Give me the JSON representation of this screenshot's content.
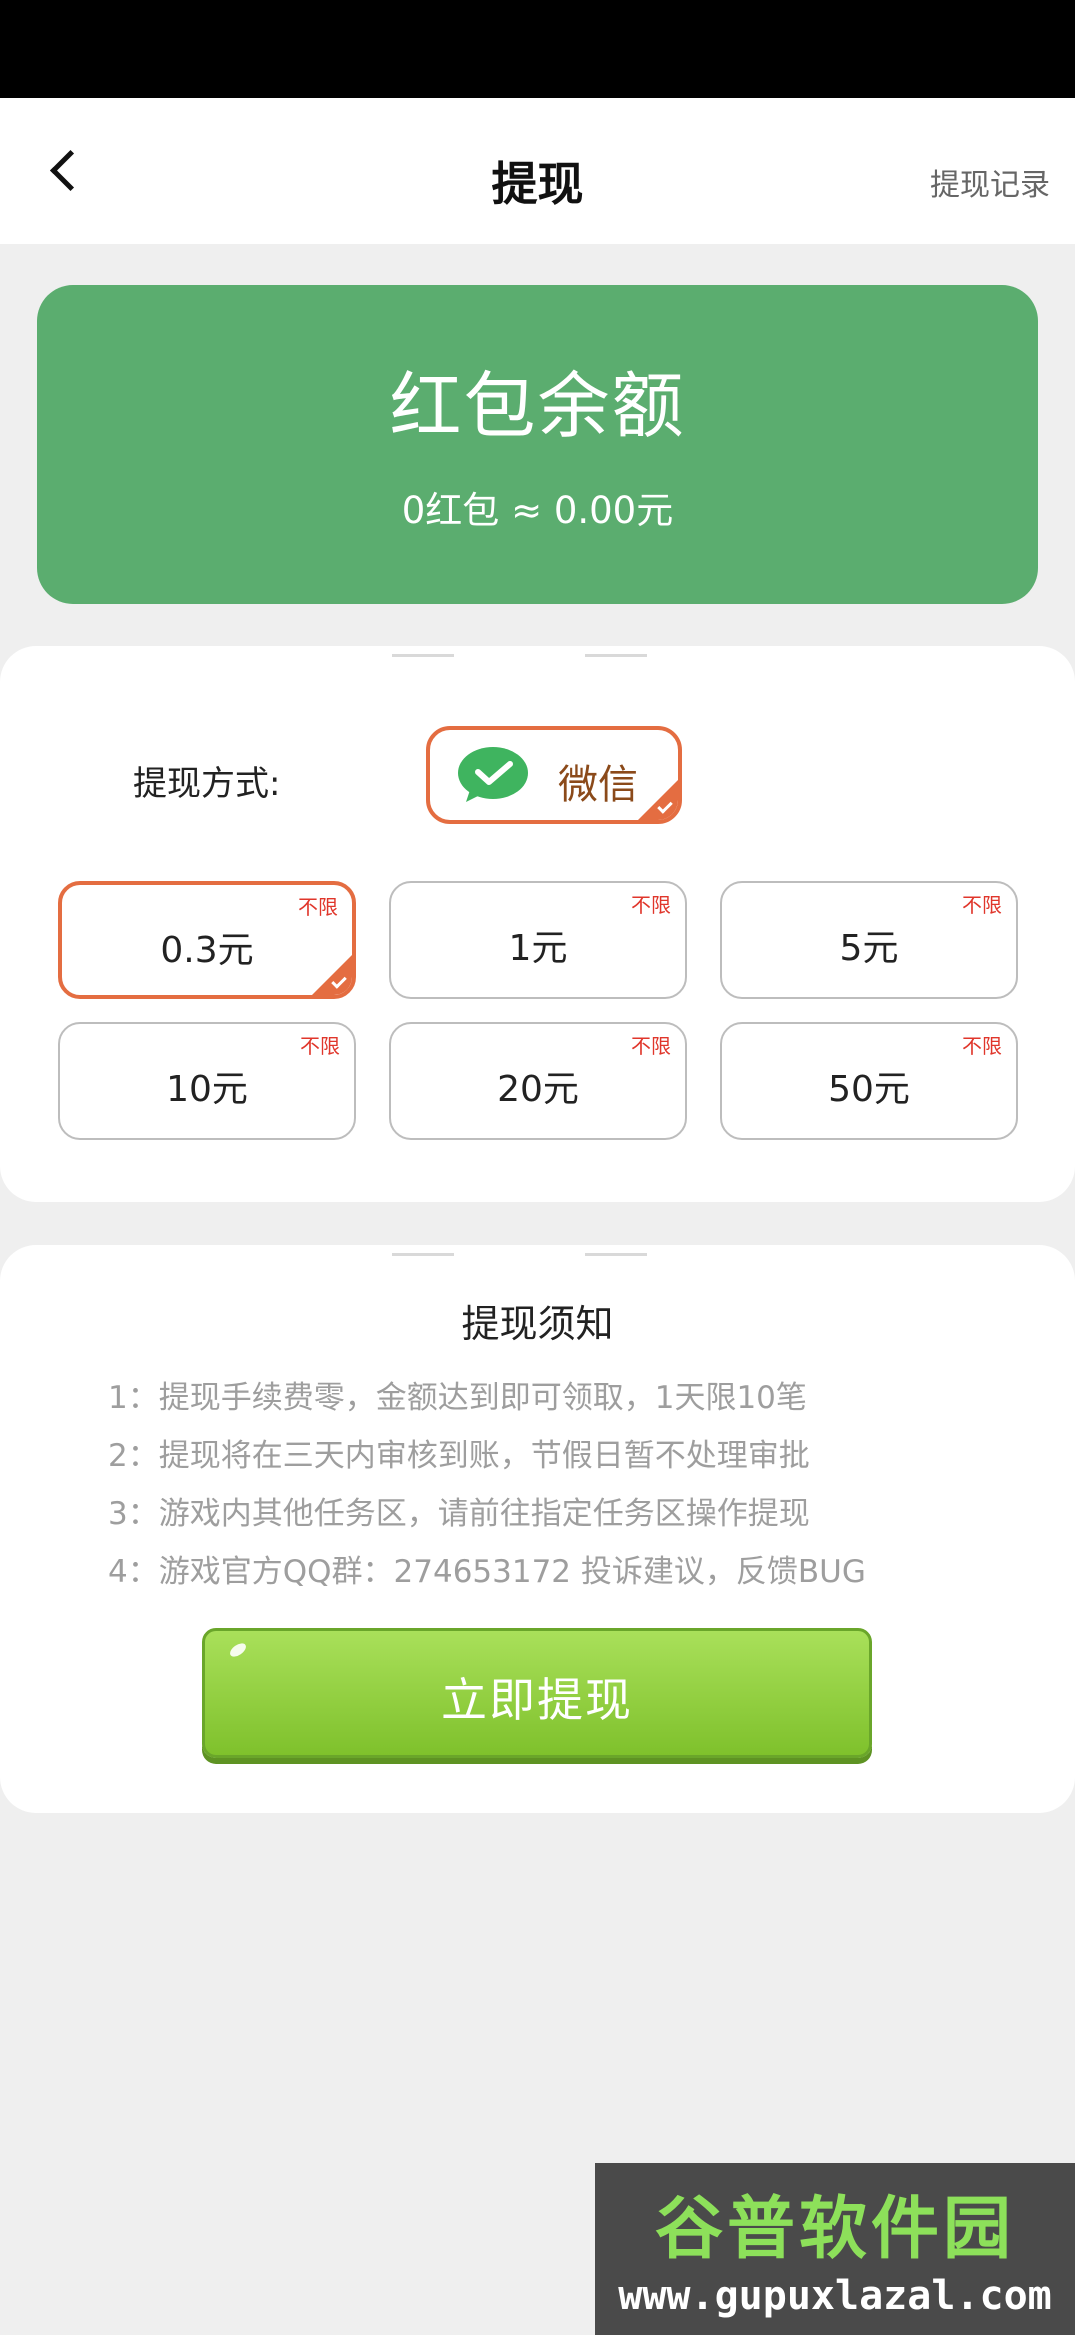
{
  "header": {
    "title": "提现",
    "record_link": "提现记录"
  },
  "balance": {
    "label": "红包余额",
    "amount": "0红包 ≈ 0.00元"
  },
  "withdraw_method": {
    "label": "提现方式:",
    "selected": "微信"
  },
  "amount_options": [
    {
      "value": "0.3元",
      "tag": "不限",
      "selected": true
    },
    {
      "value": "1元",
      "tag": "不限",
      "selected": false
    },
    {
      "value": "5元",
      "tag": "不限",
      "selected": false
    },
    {
      "value": "10元",
      "tag": "不限",
      "selected": false
    },
    {
      "value": "20元",
      "tag": "不限",
      "selected": false
    },
    {
      "value": "50元",
      "tag": "不限",
      "selected": false
    }
  ],
  "notice": {
    "title": "提现须知",
    "items": [
      "1：提现手续费零，金额达到即可领取，1天限10笔",
      "2：提现将在三天内审核到账，节假日暂不处理审批",
      "3：游戏内其他任务区，请前往指定任务区操作提现",
      "4：游戏官方QQ群：274653172 投诉建议，反馈BUG"
    ]
  },
  "submit_label": "立即提现",
  "watermark": {
    "top": "谷普软件园",
    "bottom": "www.gupuxlazal.com"
  },
  "colors": {
    "accent": "#e46d41",
    "balance_bg": "#5bad6f",
    "button_green": "#8bcb3a",
    "tag_red": "#e0362b"
  }
}
